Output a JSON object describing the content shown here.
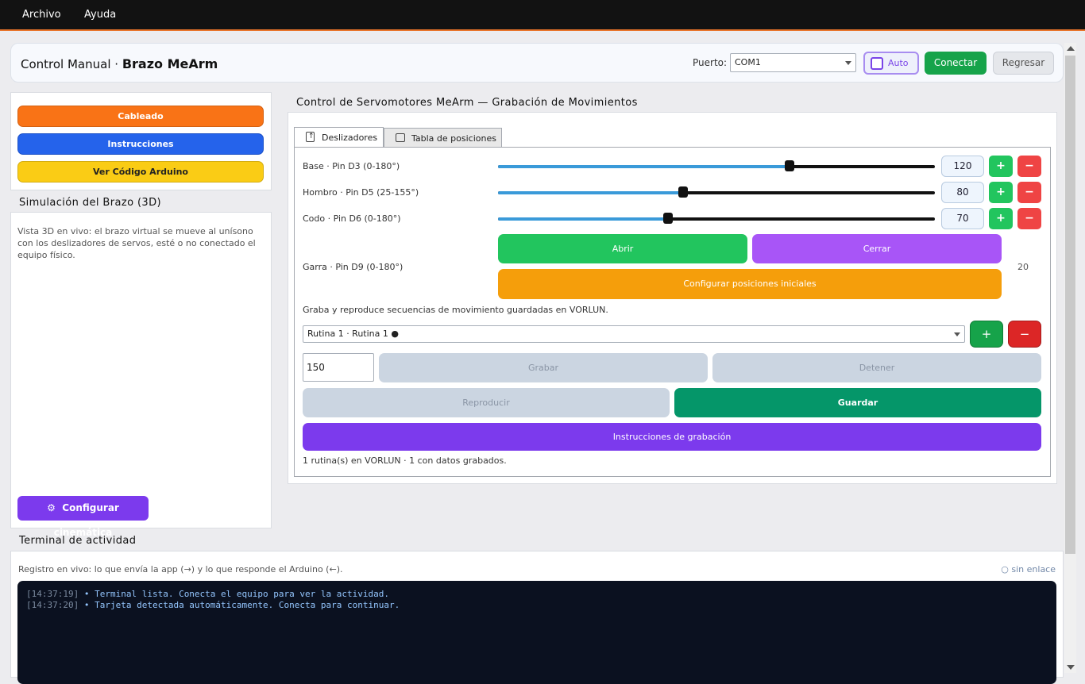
{
  "menubar": {
    "items": [
      "Archivo",
      "Ayuda"
    ]
  },
  "header": {
    "title_prefix": "Control Manual · ",
    "title_bold": "Brazo MeArm",
    "port_label": "Puerto:",
    "port_value": "COM1",
    "auto_label": "Auto",
    "auto_checked": false,
    "connect_label": "Conectar",
    "back_label": "Regresar"
  },
  "sidebar": {
    "buttons": [
      {
        "label": "Cableado",
        "color": "#f97316"
      },
      {
        "label": "Instrucciones",
        "color": "#2563eb"
      },
      {
        "label": "Ver Código Arduino",
        "color": "#facc15"
      }
    ],
    "sim_title": "Simulación del Brazo (3D)",
    "sim_description": "Vista 3D en vivo: el brazo virtual se mueve al unísono con los deslizadores de servos, esté o no conectado el equipo físico.",
    "kinematics_button": "Configurar cinemática",
    "kinematics_icon": "gear-icon"
  },
  "servo_panel": {
    "title": "Control de Servomotores MeArm — Grabación de Movimientos",
    "tabs": [
      {
        "label": "Deslizadores",
        "icon": "upload-icon",
        "active": true
      },
      {
        "label": "Tabla de posiciones",
        "icon": "table-icon",
        "active": false
      }
    ],
    "servos": [
      {
        "label": "Base · Pin D3 (0-180°)",
        "value": 120,
        "min": 0,
        "max": 180
      },
      {
        "label": "Hombro · Pin D5 (25-155°)",
        "value": 80,
        "min": 25,
        "max": 155
      },
      {
        "label": "Codo · Pin D6 (0-180°)",
        "value": 70,
        "min": 0,
        "max": 180
      }
    ],
    "plus_label": "+",
    "minus_label": "−",
    "gripper": {
      "label": "Garra · Pin D9 (0-180°)",
      "open_label": "Abrir",
      "close_label": "Cerrar",
      "config_label": "Configurar posiciones iniciales",
      "value": "20"
    },
    "recording": {
      "description": "Graba y reproduce secuencias de movimiento guardadas en VORLUN.",
      "routine_selected": "Rutina 1 · Rutina 1 ●",
      "add_label": "+",
      "remove_label": "−",
      "interval_value": "150",
      "record_label": "Grabar",
      "stop_label": "Detener",
      "play_label": "Reproducir",
      "save_label": "Guardar",
      "instructions_label": "Instrucciones de grabación",
      "status": "1 rutina(s) en VORLUN · 1 con datos grabados."
    }
  },
  "terminal": {
    "title": "Terminal de actividad",
    "description": "Registro en vivo: lo que envía la app (→) y lo que responde el Arduino (←).",
    "link_status": "○ sin enlace",
    "lines": [
      {
        "time": "[14:37:19]",
        "text": "• Terminal lista. Conecta el equipo para ver la actividad."
      },
      {
        "time": "[14:37:20]",
        "text": "• Tarjeta detectada automáticamente. Conecta para continuar."
      }
    ]
  }
}
